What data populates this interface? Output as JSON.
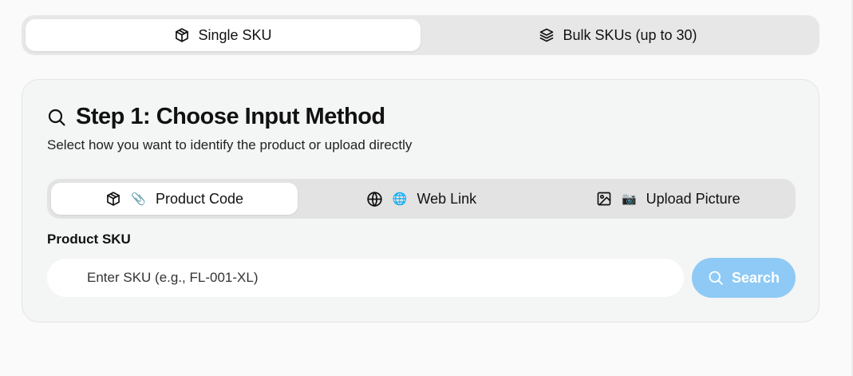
{
  "mode_switch": {
    "tabs": [
      {
        "label": "Single SKU",
        "icon": "box-icon",
        "active": true
      },
      {
        "label": "Bulk SKUs (up to 30)",
        "icon": "layers-icon",
        "active": false
      }
    ]
  },
  "step_card": {
    "title": "Step 1: Choose Input Method",
    "subtitle": "Select how you want to identify the product or upload directly",
    "title_icon": "search-icon",
    "method_tabs": [
      {
        "label": "Product Code",
        "icon": "box-icon",
        "emoji": "📎",
        "active": true
      },
      {
        "label": "Web Link",
        "icon": "globe-icon",
        "emoji": "🌐",
        "active": false
      },
      {
        "label": "Upload Picture",
        "icon": "image-icon",
        "emoji": "📷",
        "active": false
      }
    ],
    "field_label": "Product SKU",
    "input": {
      "placeholder": "Enter SKU (e.g., FL-001-XL)",
      "value": ""
    },
    "search_label": "Search"
  },
  "colors": {
    "search_button_bg": "#8ecaf5",
    "switch_bg": "#e7e7e7",
    "card_bg": "#f4f5f5"
  }
}
